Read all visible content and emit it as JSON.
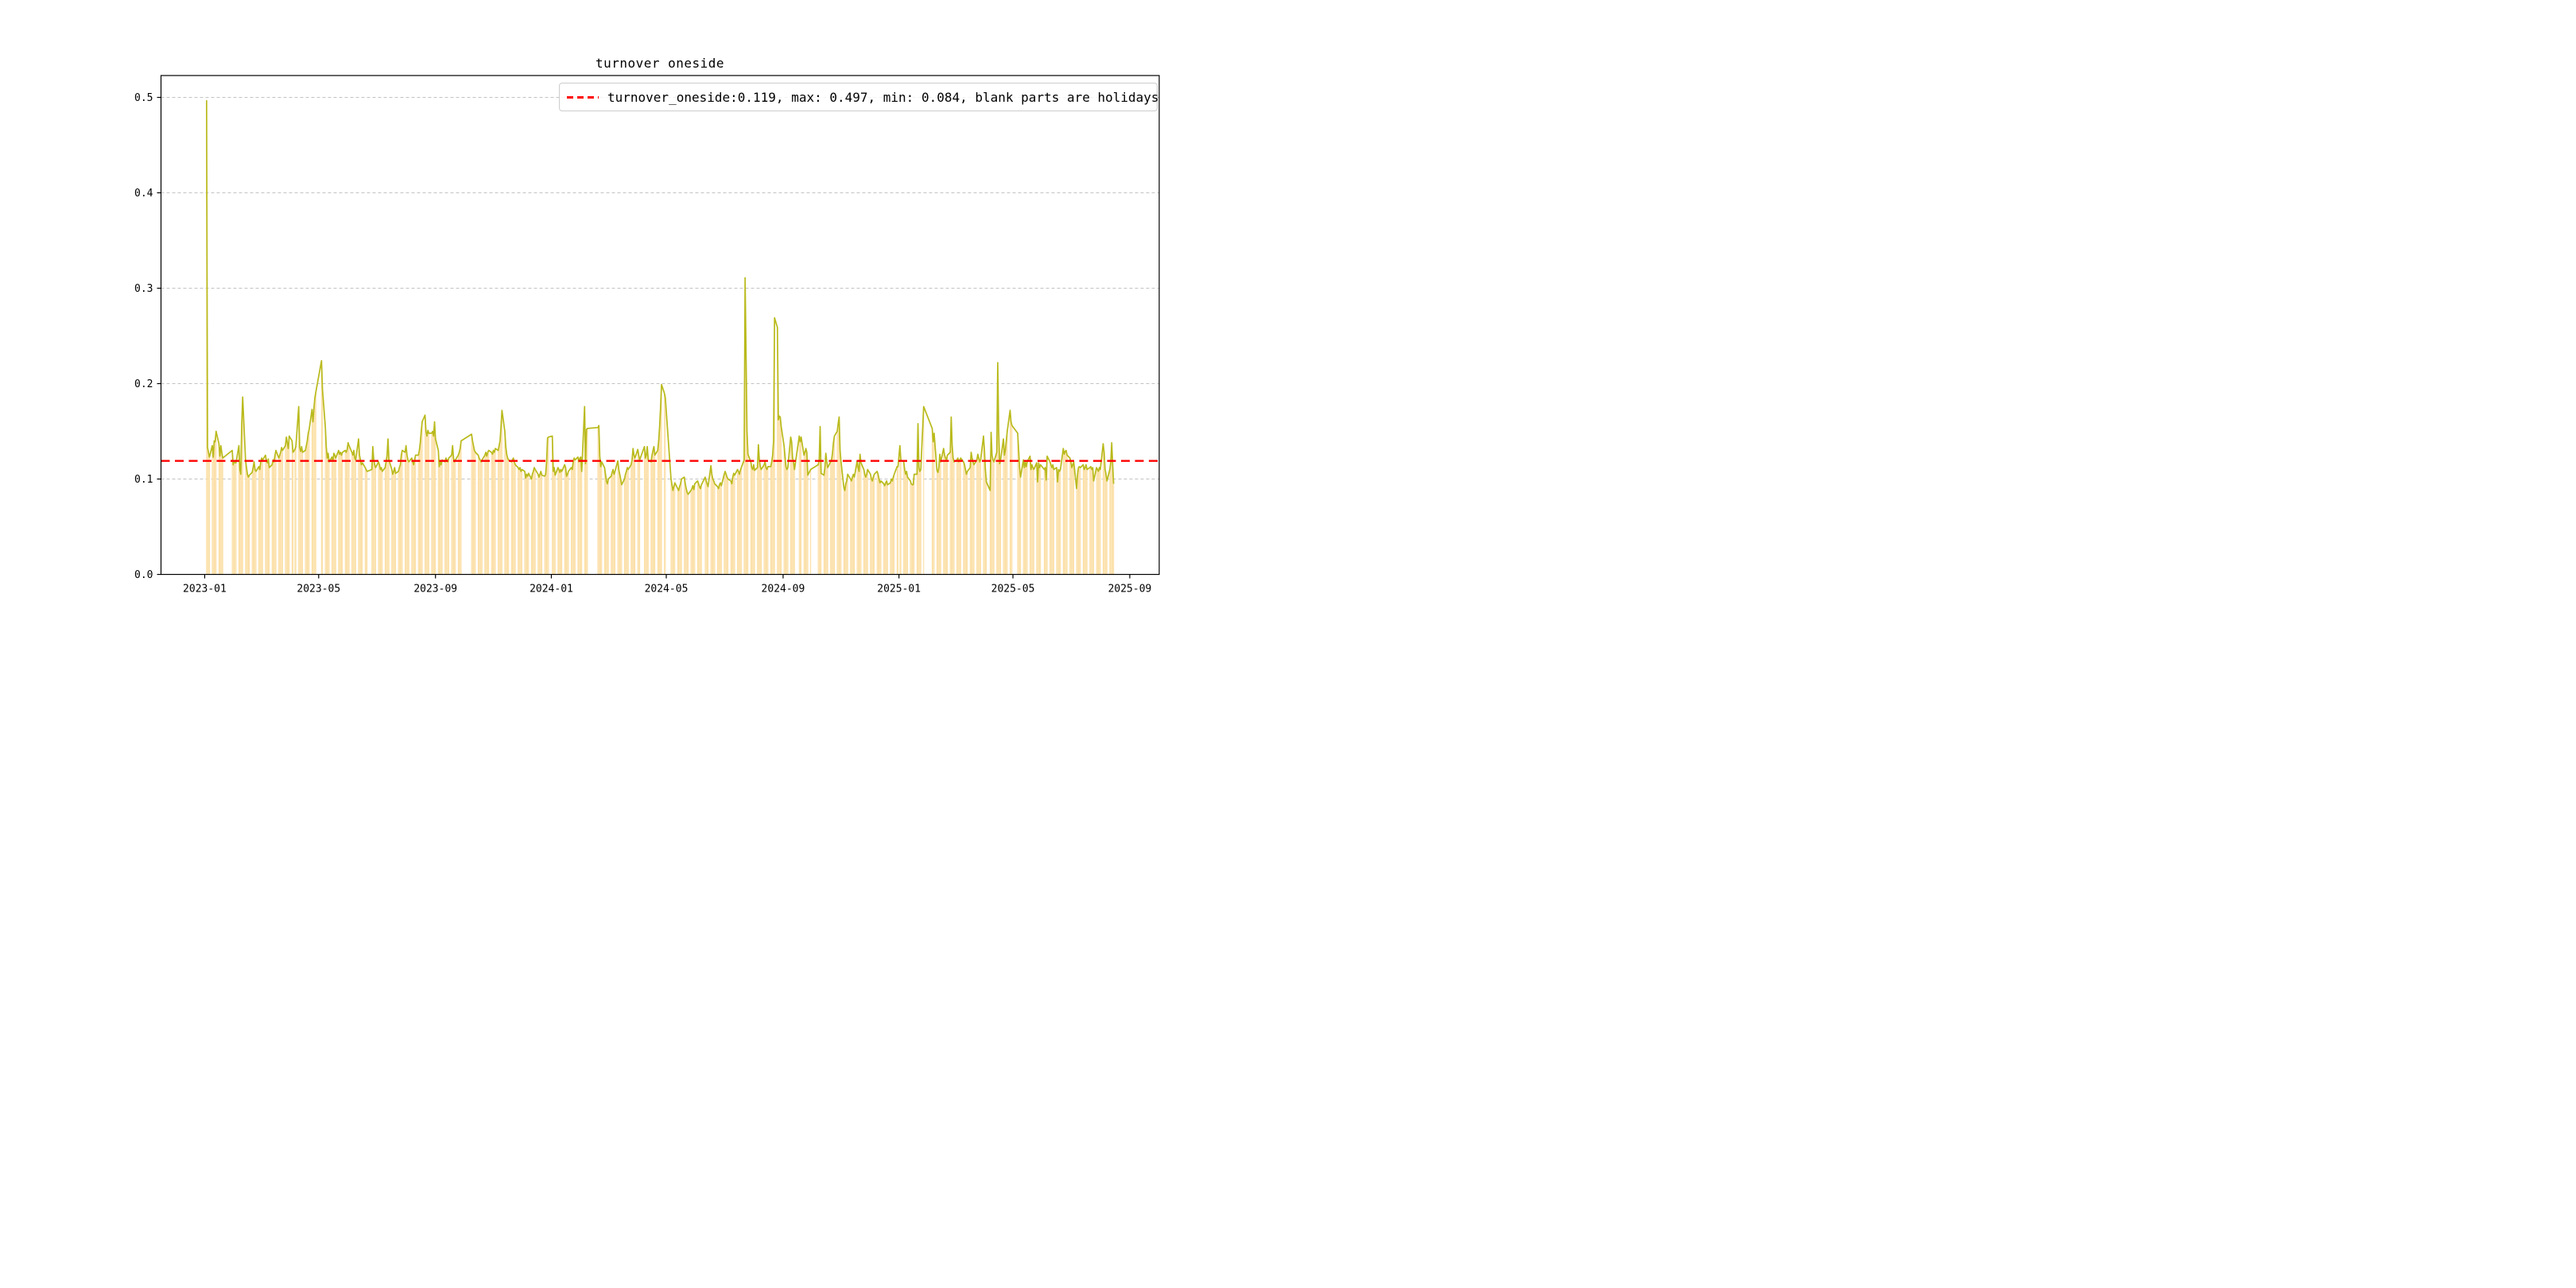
{
  "chart_data": {
    "type": "bar+line",
    "title": "turnover oneside",
    "legend_label": "turnover_oneside:0.119, max: 0.497, min: 0.084, blank parts are holidays",
    "legend_position": "upper right",
    "series_name": "turnover_oneside",
    "stats": {
      "current": 0.119,
      "max": 0.497,
      "min": 0.084
    },
    "reference_line": {
      "value": 0.119,
      "color": "#ff0000",
      "style": "dashed"
    },
    "colors": {
      "bar": "#fbdfa6",
      "line": "#b9ba1c",
      "grid": "#b0b0b0",
      "frame": "#000000",
      "reference": "#ff0000"
    },
    "grid": true,
    "ylim": [
      0,
      0.5229
    ],
    "y_ticks": [
      "0.0",
      "0.1",
      "0.2",
      "0.3",
      "0.4",
      "0.5"
    ],
    "x_ticks": [
      "2023-01",
      "2023-05",
      "2023-09",
      "2024-01",
      "2024-05",
      "2024-09",
      "2025-01",
      "2025-05",
      "2025-09"
    ],
    "x_axis": {
      "start_date": "2022-11-16",
      "end_date": "2025-10-02"
    },
    "holidays_note": "blank parts are holidays",
    "week0_monday": "2023-01-02",
    "weekly_values": [
      [
        null,
        0.497,
        0.133,
        0.128,
        0.123
      ],
      [
        0.135,
        0.123,
        0.14,
        0.139,
        0.15
      ],
      [
        0.137,
        0.124,
        0.135,
        0.128,
        0.122
      ],
      [
        null,
        null,
        null,
        null,
        null
      ],
      [
        0.13,
        0.115,
        0.119,
        0.117,
        0.117
      ],
      [
        0.135,
        0.11,
        0.105,
        0.157,
        0.186
      ],
      [
        0.12,
        0.112,
        0.105,
        0.102,
        0.104
      ],
      [
        0.107,
        0.112,
        0.118,
        0.11,
        0.108
      ],
      [
        0.113,
        0.11,
        0.118,
        0.122,
        0.12
      ],
      [
        0.125,
        0.119,
        0.117,
        0.121,
        0.112
      ],
      [
        0.115,
        0.12,
        0.118,
        0.125,
        0.13
      ],
      [
        0.122,
        0.125,
        0.128,
        0.133,
        0.13
      ],
      [
        0.135,
        0.144,
        0.138,
        0.132,
        0.145
      ],
      [
        0.14,
        0.128,
        null,
        0.131,
        0.134
      ],
      [
        0.176,
        0.133,
        0.129,
        0.134,
        0.128
      ],
      [
        0.13,
        0.135,
        0.14,
        0.148,
        0.152
      ],
      [
        0.173,
        0.16,
        0.174,
        0.185,
        0.191
      ],
      [
        null,
        null,
        null,
        0.224,
        0.194
      ],
      [
        0.155,
        0.134,
        0.122,
        0.127,
        0.118
      ],
      [
        0.123,
        0.119,
        0.127,
        0.125,
        0.122
      ],
      [
        0.13,
        0.126,
        0.128,
        0.125,
        0.128
      ],
      [
        0.13,
        0.128,
        0.131,
        0.138,
        0.135
      ],
      [
        0.128,
        0.125,
        0.13,
        0.122,
        0.12
      ],
      [
        0.142,
        0.125,
        0.12,
        0.115,
        0.117
      ],
      [
        0.112,
        0.11,
        0.108,
        null,
        null
      ],
      [
        0.11,
        0.134,
        0.12,
        0.115,
        0.112
      ],
      [
        0.118,
        0.115,
        0.11,
        0.112,
        0.108
      ],
      [
        0.112,
        0.118,
        0.125,
        0.142,
        0.12
      ],
      [
        0.11,
        0.105,
        0.108,
        0.112,
        0.106
      ],
      [
        0.108,
        0.112,
        0.115,
        0.125,
        0.13
      ],
      [
        0.128,
        0.135,
        0.125,
        0.12,
        0.118
      ],
      [
        0.122,
        0.118,
        0.115,
        0.12,
        0.125
      ],
      [
        0.125,
        0.13,
        0.138,
        0.15,
        0.16
      ],
      [
        0.167,
        0.15,
        0.145,
        0.151,
        0.148
      ],
      [
        0.148,
        0.15,
        0.145,
        0.16,
        0.142
      ],
      [
        0.13,
        0.113,
        0.118,
        0.115,
        0.12
      ],
      [
        0.118,
        0.122,
        0.12,
        0.118,
        0.122
      ],
      [
        0.125,
        0.135,
        0.122,
        0.118,
        0.12
      ],
      [
        0.125,
        0.128,
        0.132,
        0.14,
        null
      ],
      [
        null,
        null,
        null,
        null,
        null
      ],
      [
        0.147,
        0.14,
        0.135,
        0.13,
        0.128
      ],
      [
        0.125,
        0.122,
        0.12,
        0.118,
        0.12
      ],
      [
        0.125,
        0.128,
        0.124,
        0.128,
        0.13
      ],
      [
        0.128,
        0.126,
        0.13,
        0.128,
        0.132
      ],
      [
        0.13,
        0.135,
        0.14,
        0.155,
        0.172
      ],
      [
        0.15,
        0.134,
        0.126,
        0.122,
        0.12
      ],
      [
        0.118,
        0.12,
        0.122,
        0.118,
        0.115
      ],
      [
        0.112,
        0.11,
        0.112,
        0.108,
        0.11
      ],
      [
        0.108,
        0.101,
        0.105,
        0.103,
        0.106
      ],
      [
        0.1,
        0.105,
        0.108,
        0.112,
        0.11
      ],
      [
        0.105,
        0.102,
        0.105,
        0.108,
        0.104
      ],
      [
        0.103,
        0.105,
        0.118,
        0.143,
        0.144
      ],
      [
        null,
        0.145,
        0.108,
        0.112,
        0.104
      ],
      [
        0.112,
        0.11,
        0.107,
        0.11,
        0.108
      ],
      [
        0.115,
        0.112,
        0.103,
        0.105,
        0.108
      ],
      [
        0.112,
        0.11,
        0.118,
        0.122,
        0.12
      ],
      [
        0.123,
        0.118,
        0.122,
        0.123,
        0.108
      ],
      [
        0.176,
        0.116,
        0.152,
        0.153,
        null
      ],
      [
        null,
        null,
        null,
        null,
        null
      ],
      [
        0.154,
        0.156,
        0.124,
        0.113,
        0.118
      ],
      [
        0.112,
        0.105,
        0.098,
        0.095,
        0.1
      ],
      [
        0.103,
        0.107,
        0.11,
        0.105,
        0.108
      ],
      [
        0.119,
        0.11,
        0.105,
        0.1,
        0.094
      ],
      [
        0.1,
        0.105,
        0.108,
        0.112,
        0.11
      ],
      [
        0.115,
        0.12,
        0.132,
        0.125,
        0.122
      ],
      [
        0.131,
        0.125,
        0.12,
        null,
        null
      ],
      [
        0.134,
        0.122,
        0.125,
        0.134,
        0.12
      ],
      [
        0.118,
        0.125,
        0.13,
        0.134,
        0.125
      ],
      [
        0.13,
        0.14,
        0.155,
        0.175,
        0.199
      ],
      [
        0.19,
        0.185,
        null,
        null,
        null
      ],
      [
        0.1,
        0.094,
        0.088,
        0.092,
        0.096
      ],
      [
        0.09,
        0.088,
        0.092,
        0.095,
        0.1
      ],
      [
        0.102,
        0.095,
        0.09,
        0.086,
        0.084
      ],
      [
        0.088,
        0.09,
        0.093,
        0.089,
        0.095
      ],
      [
        0.098,
        0.095,
        0.092,
        0.09,
        0.094
      ],
      [
        null,
        0.102,
        0.098,
        0.095,
        0.092
      ],
      [
        0.114,
        0.105,
        0.1,
        0.098,
        0.095
      ],
      [
        0.092,
        0.09,
        0.094,
        0.096,
        0.093
      ],
      [
        0.105,
        0.108,
        0.105,
        0.102,
        0.1
      ],
      [
        0.098,
        0.095,
        0.102,
        0.106,
        0.104
      ],
      [
        0.11,
        0.108,
        0.105,
        0.109,
        0.112
      ],
      [
        0.12,
        0.311,
        0.23,
        0.15,
        0.126
      ],
      [
        0.118,
        0.112,
        0.11,
        0.115,
        0.109
      ],
      [
        0.112,
        0.136,
        0.12,
        0.113,
        0.11
      ],
      [
        0.115,
        0.118,
        0.112,
        0.11,
        0.113
      ],
      [
        0.113,
        0.118,
        0.125,
        0.14,
        0.269
      ],
      [
        0.259,
        0.162,
        0.166,
        0.165,
        0.155
      ],
      [
        0.135,
        0.124,
        0.113,
        0.11,
        0.112
      ],
      [
        0.144,
        0.139,
        0.122,
        0.118,
        0.11
      ],
      [
        null,
        null,
        0.145,
        0.139,
        0.144
      ],
      [
        0.125,
        0.128,
        0.132,
        0.128,
        0.104
      ],
      [
        0.11,
        null,
        null,
        null,
        null
      ],
      [
        null,
        0.115,
        0.12,
        0.155,
        0.106
      ],
      [
        0.104,
        0.112,
        0.127,
        0.118,
        0.112
      ],
      [
        0.118,
        0.12,
        0.127,
        0.138,
        0.145
      ],
      [
        0.15,
        0.158,
        0.165,
        0.13,
        0.118
      ],
      [
        0.091,
        0.088,
        0.095,
        0.098,
        0.105
      ],
      [
        0.1,
        0.098,
        0.102,
        0.105,
        0.102
      ],
      [
        0.119,
        0.112,
        0.108,
        0.126,
        0.117
      ],
      [
        0.11,
        0.105,
        0.102,
        0.105,
        0.11
      ],
      [
        0.105,
        0.1,
        0.098,
        0.102,
        0.105
      ],
      [
        0.108,
        0.105,
        0.1,
        0.096,
        0.098
      ],
      [
        0.095,
        0.093,
        0.096,
        0.098,
        0.094
      ],
      [
        0.096,
        0.1,
        0.098,
        0.102,
        0.105
      ],
      [
        0.113,
        0.113,
        null,
        0.135,
        0.12
      ],
      [
        0.118,
        0.11,
        0.105,
        0.108,
        0.102
      ],
      [
        0.098,
        0.095,
        0.094,
        0.094,
        0.105
      ],
      [
        0.105,
        0.158,
        0.112,
        0.108,
        0.11
      ],
      [
        0.176,
        null,
        null,
        null,
        null
      ],
      [
        null,
        null,
        0.153,
        0.139,
        0.148
      ],
      [
        0.109,
        0.107,
        0.112,
        0.126,
        0.118
      ],
      [
        0.132,
        0.125,
        0.122,
        0.12,
        0.125
      ],
      [
        0.128,
        0.165,
        0.135,
        0.122,
        0.118
      ],
      [
        0.12,
        0.122,
        0.118,
        0.12,
        0.122
      ],
      [
        0.118,
        0.115,
        0.11,
        0.105,
        0.108
      ],
      [
        0.112,
        0.128,
        0.122,
        0.118,
        0.115
      ],
      [
        0.12,
        0.126,
        0.122,
        0.118,
        0.12
      ],
      [
        0.145,
        0.13,
        0.11,
        0.097,
        null
      ],
      [
        0.088,
        0.149,
        0.125,
        0.12,
        0.118
      ],
      [
        0.128,
        0.222,
        0.15,
        0.116,
        0.12
      ],
      [
        0.142,
        0.125,
        0.13,
        0.14,
        0.15
      ],
      [
        0.172,
        0.16,
        0.156,
        null,
        null
      ],
      [
        null,
        0.148,
        0.13,
        0.112,
        0.102
      ],
      [
        0.12,
        0.112,
        0.118,
        0.113,
        0.118
      ],
      [
        0.124,
        0.11,
        0.115,
        0.112,
        0.11
      ],
      [
        0.117,
        0.097,
        0.117,
        0.112,
        0.115
      ],
      [
        null,
        0.11,
        0.112,
        0.099,
        0.124
      ],
      [
        0.118,
        0.115,
        0.112,
        0.115,
        0.11
      ],
      [
        0.112,
        0.097,
        0.11,
        0.108,
        0.11
      ],
      [
        0.132,
        0.126,
        0.129,
        0.13,
        0.125
      ],
      [
        0.122,
        0.118,
        0.112,
        0.115,
        0.118
      ],
      [
        0.09,
        0.105,
        0.112,
        0.113,
        0.112
      ],
      [
        0.115,
        0.11,
        0.112,
        0.115,
        0.11
      ],
      [
        0.112,
        0.113,
        0.11,
        0.112,
        0.098
      ],
      [
        0.112,
        0.11,
        0.108,
        0.112,
        0.11
      ],
      [
        0.137,
        0.128,
        0.11,
        0.105,
        0.098
      ],
      [
        0.11,
        0.118,
        0.138,
        0.115,
        0.095
      ]
    ]
  }
}
